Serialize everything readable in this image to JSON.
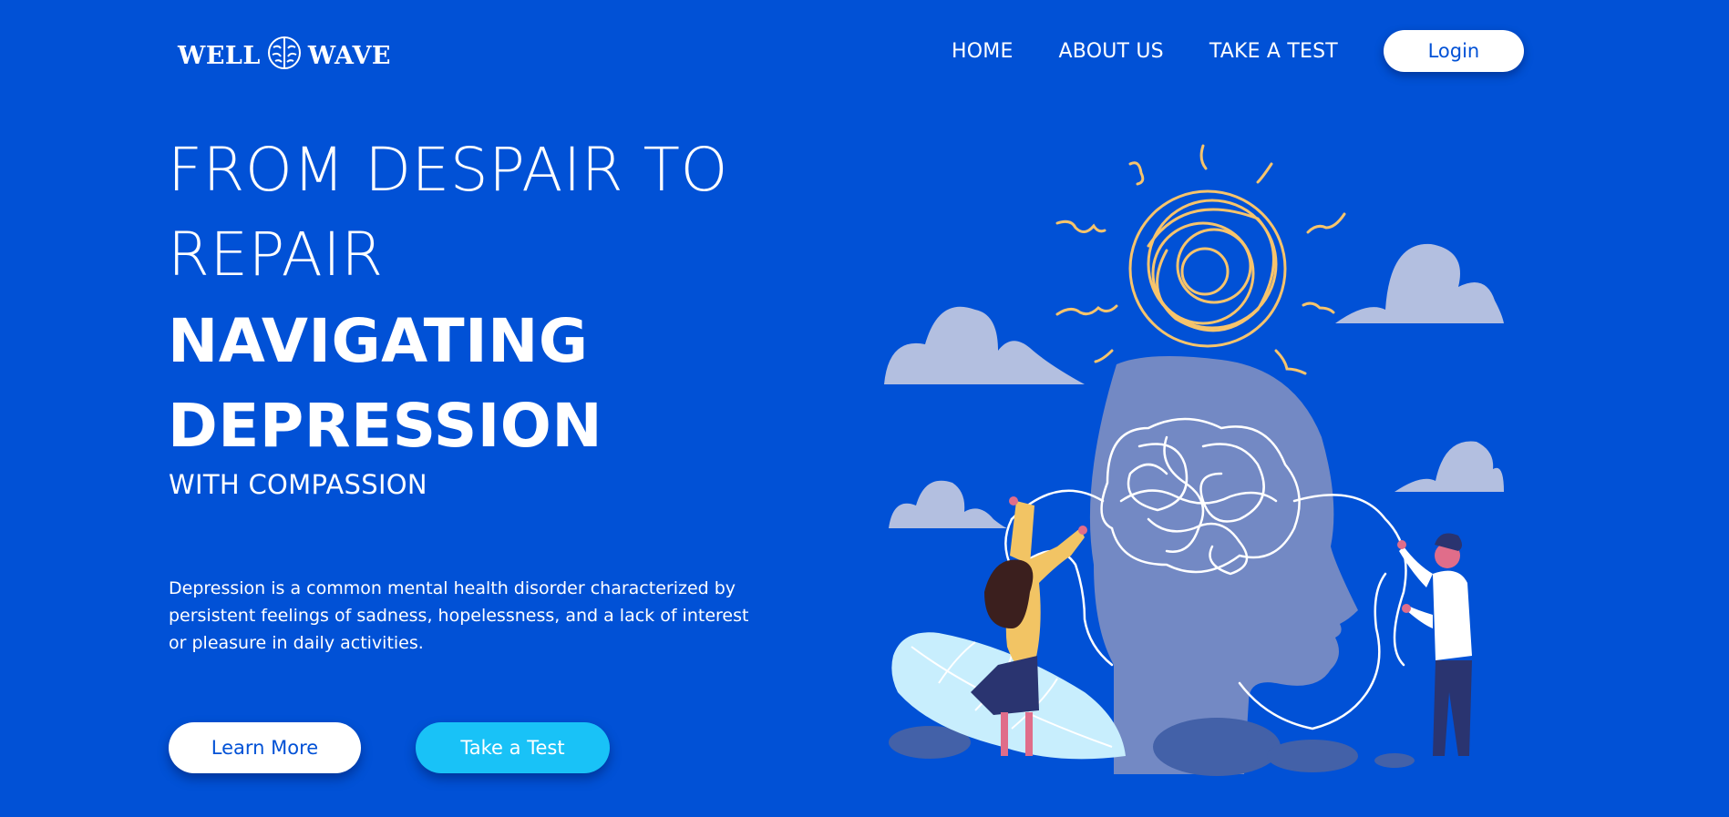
{
  "header": {
    "logo_left": "WELL",
    "logo_icon": "brain-icon",
    "logo_right": "WAVE",
    "nav": [
      {
        "label": "HOME"
      },
      {
        "label": "ABOUT US"
      },
      {
        "label": "TAKE A TEST"
      }
    ],
    "login_label": "Login"
  },
  "hero": {
    "line1": "FROM DESPAIR TO REPAIR",
    "line2": "NAVIGATING DEPRESSION",
    "line3": "WITH COMPASSION",
    "description": "Depression is a common mental health disorder characterized by persistent feelings of sadness, hopelessness, and a lack of interest or pleasure in daily activities.",
    "learn_more_label": "Learn More",
    "take_test_label": "Take a Test"
  },
  "illustration": {
    "icons": [
      "tangled-thoughts-head-illustration",
      "cloud-icon",
      "scribble-sun-icon",
      "woman-figure",
      "man-figure",
      "leaf-icon"
    ]
  },
  "colors": {
    "background": "#0151d6",
    "accent_button": "#19c2f7",
    "head": "#7389c4",
    "cloud": "#b3bfe0",
    "scribble": "#f7c46c"
  }
}
